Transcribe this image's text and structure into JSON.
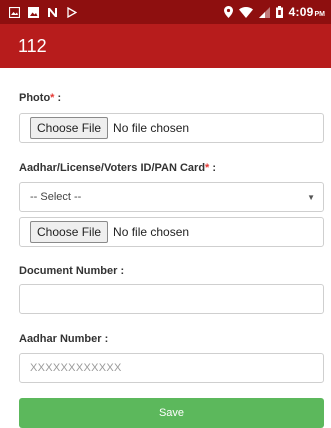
{
  "status_bar": {
    "time": "4:09",
    "ampm": "PM",
    "left_icons": [
      "gallery-icon",
      "image-icon",
      "n-icon",
      "play-icon"
    ],
    "right_icons": [
      "location-icon",
      "wifi-icon",
      "signal-icon",
      "battery-icon"
    ]
  },
  "app_bar": {
    "title": "112",
    "color": "#b71c1c"
  },
  "form": {
    "photo": {
      "label": "Photo",
      "required_mark": "*",
      "label_suffix": " :",
      "button": "Choose File",
      "status": "No file chosen"
    },
    "id_document": {
      "label": "Aadhar/License/Voters ID/PAN Card",
      "required_mark": "*",
      "label_suffix": " :",
      "select_value": "-- Select --",
      "button": "Choose File",
      "status": "No file chosen"
    },
    "document_number": {
      "label": "Document Number :",
      "value": ""
    },
    "aadhar_number": {
      "label": "Aadhar Number :",
      "placeholder": "XXXXXXXXXXXX"
    },
    "save_label": "Save",
    "save_color": "#5cb85c"
  }
}
